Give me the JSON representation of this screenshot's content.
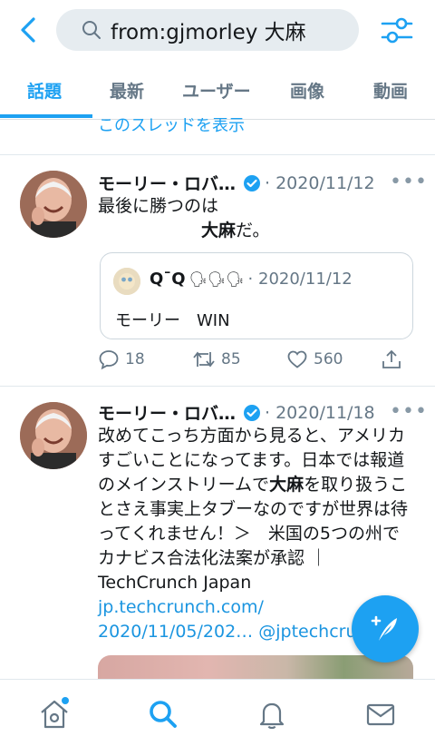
{
  "search": {
    "query": "from:gjmorley 大麻"
  },
  "tabs": [
    "話題",
    "最新",
    "ユーザー",
    "画像",
    "動画"
  ],
  "thread_link": "このスレッドを表示",
  "tweets": [
    {
      "name": "モーリー・ロバ…",
      "date": "· 2020/11/12",
      "more": "•••",
      "text_line1": "最後に勝つのは",
      "text_indent": "　　　　　　",
      "text_bold": "大麻",
      "text_tail": "だ。",
      "quote": {
        "name": "Q¯Q",
        "emoji": "🗣🗣🗣",
        "date": "· 2020/11/12",
        "text": "モーリー　WIN"
      },
      "replies": "18",
      "retweets": "85",
      "likes": "560"
    },
    {
      "name": "モーリー・ロバ…",
      "date": "· 2020/11/18",
      "more": "•••",
      "text_part1": "改めてこっち方面から見ると、アメリカすごいことになってます。日本では報道のメインストリームで",
      "text_bold": "大麻",
      "text_part2": "を取り扱うことさえ事実上タブーなのですが世界は待ってくれません！＞　米国の5つの州でカナビス合法化法案が承認 ｜ TechCrunch Japan",
      "link1": "jp.techcrunch.com/",
      "link2": "2020/11/05/202…",
      "mention": "@jptechcru"
    }
  ],
  "colors": {
    "accent": "#1da1f2",
    "muted": "#657786"
  }
}
